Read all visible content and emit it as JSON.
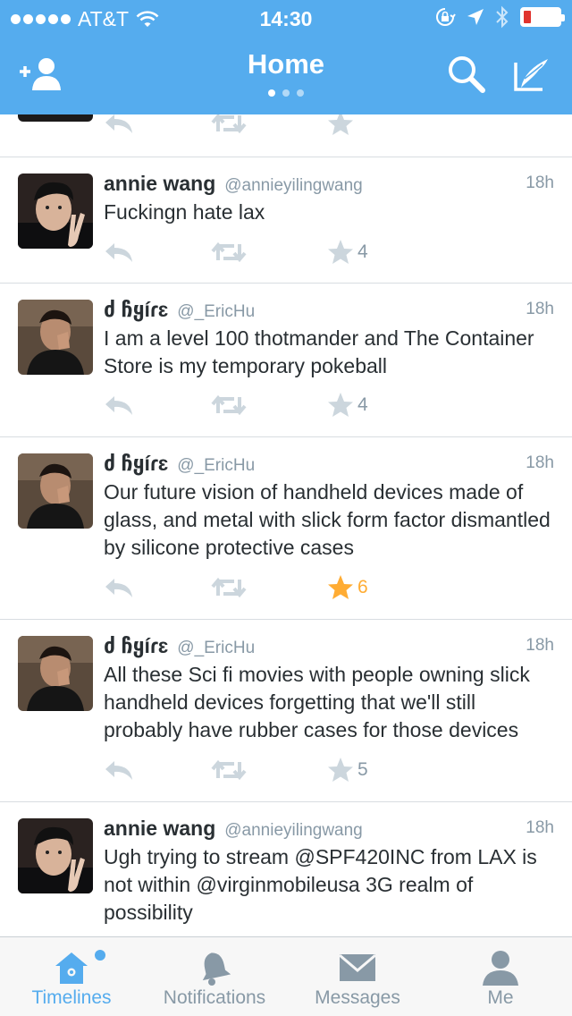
{
  "status_bar": {
    "carrier": "AT&T",
    "time": "14:30",
    "signal_icon": "signal-dots-icon",
    "wifi_icon": "wifi-icon",
    "battery_level": 0.1
  },
  "header": {
    "title": "Home",
    "pages": 3,
    "active_page": 0,
    "add_user_icon": "add-user-icon",
    "search_icon": "search-icon",
    "compose_icon": "compose-icon",
    "color": "#55acee"
  },
  "tweets": [
    {
      "name": "annie wang",
      "handle": "@annieyilingwang",
      "time": "18h",
      "text": "Fuckingn hate lax",
      "fav_count": "4",
      "favorited": false,
      "avatar": "annie"
    },
    {
      "name": "ძ ჩყíɾɛ",
      "handle": "@_EricHu",
      "time": "18h",
      "text": "I am a level 100 thotmander and The Container Store is my temporary pokeball",
      "fav_count": "4",
      "favorited": false,
      "avatar": "eric"
    },
    {
      "name": "ძ ჩყíɾɛ",
      "handle": "@_EricHu",
      "time": "18h",
      "text": "Our future vision of handheld devices made of glass, and metal with slick form factor dismantled by silicone protective cases",
      "fav_count": "6",
      "favorited": true,
      "avatar": "eric"
    },
    {
      "name": "ძ ჩყíɾɛ",
      "handle": "@_EricHu",
      "time": "18h",
      "text": "All these Sci fi movies with people owning slick handheld devices forgetting that we'll still probably have rubber cases for those devices",
      "fav_count": "5",
      "favorited": false,
      "avatar": "eric"
    },
    {
      "name": "annie wang",
      "handle": "@annieyilingwang",
      "time": "18h",
      "text": "Ugh trying to stream @SPF420INC from LAX is not within @virginmobileusa 3G realm of possibility",
      "fav_count": "",
      "favorited": false,
      "avatar": "annie"
    }
  ],
  "tabbar": {
    "tabs": [
      {
        "label": "Timelines",
        "icon": "home-icon",
        "active": true,
        "has_new": true
      },
      {
        "label": "Notifications",
        "icon": "bell-icon",
        "active": false
      },
      {
        "label": "Messages",
        "icon": "envelope-icon",
        "active": false
      },
      {
        "label": "Me",
        "icon": "person-icon",
        "active": false
      }
    ]
  },
  "colors": {
    "accent": "#55acee",
    "favorite": "#ffac33",
    "muted": "#8899a6"
  }
}
